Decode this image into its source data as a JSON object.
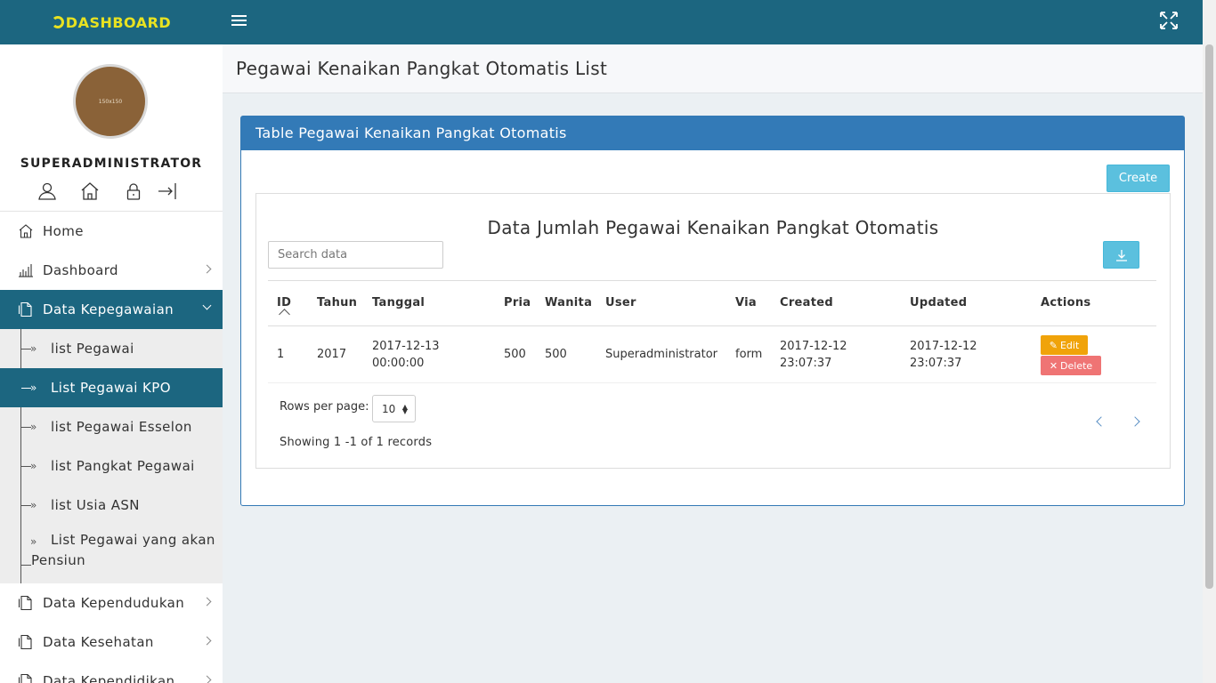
{
  "app": {
    "brand": "DASHBOARD"
  },
  "profile": {
    "avatar_text": "150x150",
    "name": "SUPERADMINISTRATOR"
  },
  "sidebar": {
    "items": [
      {
        "label": "Home",
        "icon": "home-icon"
      },
      {
        "label": "Dashboard",
        "icon": "bar-chart-icon"
      },
      {
        "label": "Data Kepegawaian",
        "icon": "document-icon",
        "expanded": true
      },
      {
        "label": "Data Kependudukan",
        "icon": "document-icon"
      },
      {
        "label": "Data Kesehatan",
        "icon": "document-icon"
      },
      {
        "label": "Data Kependidikan",
        "icon": "document-icon"
      }
    ],
    "subitems": [
      {
        "label": "list Pegawai"
      },
      {
        "label": "List Pegawai KPO",
        "active": true
      },
      {
        "label": "list Pegawai Esselon"
      },
      {
        "label": "list Pangkat Pegawai"
      },
      {
        "label": "list Usia ASN"
      },
      {
        "label": "List Pegawai yang akan Pensiun"
      }
    ]
  },
  "page": {
    "title": "Pegawai Kenaikan Pangkat Otomatis List"
  },
  "card": {
    "title": "Table Pegawai Kenaikan Pangkat Otomatis",
    "create_label": "Create",
    "table_title": "Data Jumlah Pegawai Kenaikan Pangkat Otomatis",
    "search_placeholder": "Search data"
  },
  "table": {
    "columns": [
      "ID",
      "Tahun",
      "Tanggal",
      "Pria",
      "Wanita",
      "User",
      "Via",
      "Created",
      "Updated",
      "Actions"
    ],
    "rows": [
      {
        "id": "1",
        "tahun": "2017",
        "tanggal_date": "2017-12-13",
        "tanggal_time": "00:00:00",
        "pria": "500",
        "wanita": "500",
        "user": "Superadministrator",
        "via": "form",
        "created_date": "2017-12-12",
        "created_time": "23:07:37",
        "updated_date": "2017-12-12",
        "updated_time": "23:07:37",
        "edit_label": "Edit",
        "delete_label": "Delete"
      }
    ]
  },
  "pagination": {
    "rows_per_page_label": "Rows per page:",
    "rows_per_page_value": "10",
    "showing": "Showing 1 -1 of 1 records"
  },
  "colors": {
    "topbar": "#1c6680",
    "brand": "#e8e221",
    "card_header": "#337ab7",
    "info_button": "#5bc0de",
    "edit_button": "#f0a30a",
    "delete_button": "#ef7474"
  }
}
